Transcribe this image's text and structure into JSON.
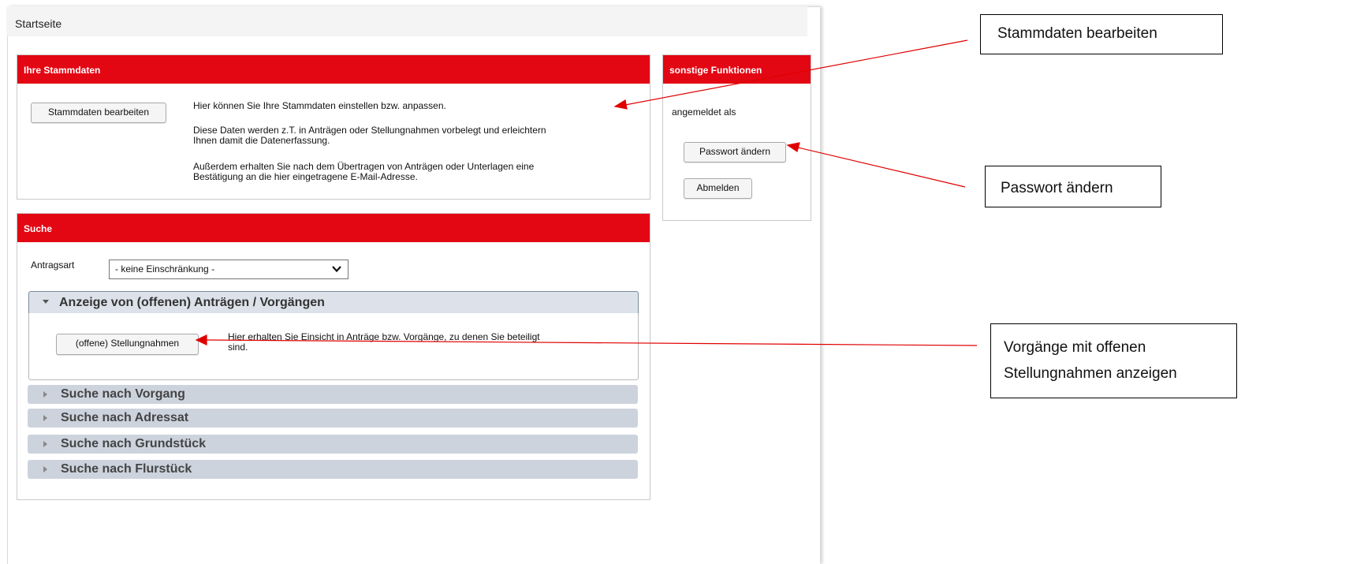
{
  "header": {
    "title": "Startseite"
  },
  "stammdaten": {
    "heading": "Ihre Stammdaten",
    "edit_button": "Stammdaten bearbeiten",
    "line1": "Hier können Sie Ihre Stammdaten einstellen bzw. anpassen.",
    "line2a": "Diese Daten werden z.T. in Anträgen oder Stellungnahmen vorbelegt und erleichtern",
    "line2b": "Ihnen damit die Datenerfassung.",
    "line3a": "Außerdem erhalten Sie nach dem Übertragen von Anträgen oder Unterlagen eine",
    "line3b": "Bestätigung an die hier eingetragene E-Mail-Adresse."
  },
  "sonstige": {
    "heading": "sonstige Funktionen",
    "logged_in_as": "angemeldet als",
    "password_button": "Passwort ändern",
    "logout_button": "Abmelden"
  },
  "suche": {
    "heading": "Suche",
    "antragsart_label": "Antragsart",
    "antragsart_value": "- keine Einschränkung -",
    "open_section": {
      "title": "Anzeige von (offenen) Anträgen / Vorgängen",
      "button": "(offene) Stellungnahmen",
      "desc_a": "Hier erhalten Sie Einsicht in Anträge bzw. Vorgänge, zu denen Sie beteiligt",
      "desc_b": "sind."
    },
    "sections": [
      "Suche nach Vorgang",
      "Suche nach Adressat",
      "Suche nach Grundstück",
      "Suche nach Flurstück"
    ]
  },
  "callouts": {
    "stammdaten": "Stammdaten bearbeiten",
    "passwort": "Passwort ändern",
    "vorgaenge_a": "Vorgänge mit offenen",
    "vorgaenge_b": "Stellungnahmen anzeigen"
  },
  "colors": {
    "accent_red": "#e30613",
    "accordion": "#cdd3dd",
    "annotation_red": "#e00000"
  }
}
